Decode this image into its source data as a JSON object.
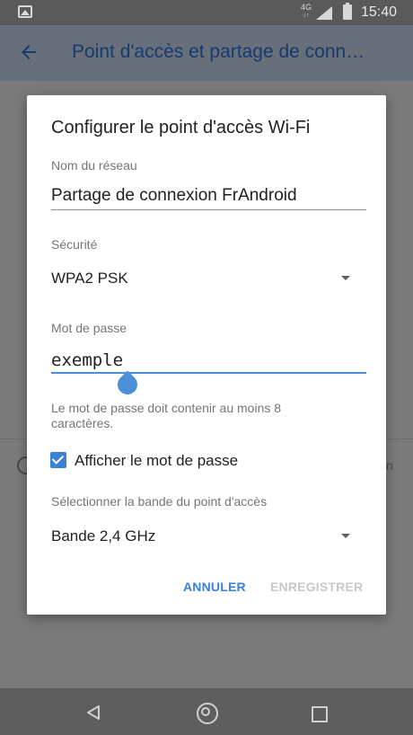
{
  "status_bar": {
    "network_type": "4G",
    "network_arrows": "↓↑",
    "time": "15:40"
  },
  "app_bar": {
    "title": "Point d'accès et partage de conn…"
  },
  "background": {
    "edge_text": "n"
  },
  "dialog": {
    "title": "Configurer le point d'accès Wi-Fi",
    "network_name": {
      "label": "Nom du réseau",
      "value": "Partage de connexion FrAndroid"
    },
    "security": {
      "label": "Sécurité",
      "value": "WPA2 PSK"
    },
    "password": {
      "label": "Mot de passe",
      "value": "exemple",
      "helper": "Le mot de passe doit contenir au moins 8 caractères."
    },
    "show_password": {
      "label": "Afficher le mot de passe",
      "checked": true
    },
    "band": {
      "label": "Sélectionner la bande du point d'accès",
      "value": "Bande 2,4 GHz"
    },
    "buttons": {
      "cancel": "ANNULER",
      "save": "ENREGISTRER"
    }
  },
  "colors": {
    "accent": "#3b82d6",
    "disabled": "#c8c8c8",
    "scrim": "#7b7b7b"
  }
}
